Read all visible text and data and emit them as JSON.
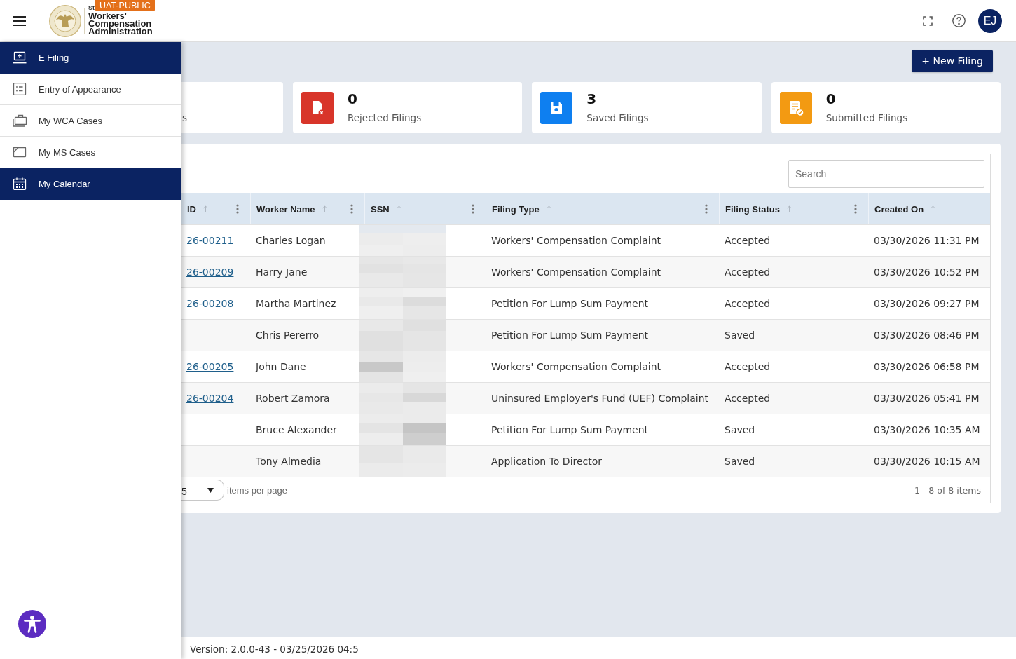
{
  "header": {
    "org_name_prefix": "St",
    "org_name": [
      "Workers'",
      "Compensation",
      "Administration"
    ],
    "environment_badge": "UAT-PUBLIC",
    "avatar_initials": "EJ"
  },
  "sidebar": {
    "items": [
      {
        "label": "E Filing",
        "selected": true
      },
      {
        "label": "Entry of Appearance",
        "selected": false
      },
      {
        "label": "My WCA Cases",
        "selected": false
      },
      {
        "label": "My MS Cases",
        "selected": false
      },
      {
        "label": "My Calendar",
        "selected": true
      }
    ]
  },
  "toolbar": {
    "new_filing_button": "+ New Filing"
  },
  "stat_cards": [
    {
      "label": "s"
    },
    {
      "count": "0",
      "label": "Rejected Filings",
      "color": "#d8352a"
    },
    {
      "count": "3",
      "label": "Saved Filings",
      "color": "#0e7ff0"
    },
    {
      "count": "0",
      "label": "Submitted Filings",
      "color": "#f39a12"
    }
  ],
  "table": {
    "search": {
      "placeholder": "Search"
    },
    "columns": [
      {
        "label": "ID",
        "has_menu": true
      },
      {
        "label": "Worker Name",
        "has_menu": true
      },
      {
        "label": "SSN",
        "has_menu": true
      },
      {
        "label": "Filing Type",
        "has_menu": true
      },
      {
        "label": "Filing Status",
        "has_menu": true
      },
      {
        "label": "Created On",
        "has_menu": false
      }
    ],
    "rows": [
      {
        "id": "26-00211",
        "worker_name": "Charles Logan",
        "filing_type": "Workers' Compensation Complaint",
        "filing_status": "Accepted",
        "created_on": "03/30/2026 11:31 PM"
      },
      {
        "id": "26-00209",
        "worker_name": "Harry Jane",
        "filing_type": "Workers' Compensation Complaint",
        "filing_status": "Accepted",
        "created_on": "03/30/2026 10:52 PM"
      },
      {
        "id": "26-00208",
        "worker_name": "Martha Martinez",
        "filing_type": "Petition For Lump Sum Payment",
        "filing_status": "Accepted",
        "created_on": "03/30/2026 09:27 PM"
      },
      {
        "worker_name": "Chris Pererro",
        "filing_type": "Petition For Lump Sum Payment",
        "filing_status": "Saved",
        "created_on": "03/30/2026 08:46 PM"
      },
      {
        "id": "26-00205",
        "worker_name": "John Dane",
        "filing_type": "Workers' Compensation Complaint",
        "filing_status": "Accepted",
        "created_on": "03/30/2026 06:58 PM"
      },
      {
        "id": "26-00204",
        "worker_name": "Robert Zamora",
        "filing_type": "Uninsured Employer's Fund (UEF) Complaint",
        "filing_status": "Accepted",
        "created_on": "03/30/2026 05:41 PM"
      },
      {
        "worker_name": "Bruce Alexander",
        "filing_type": "Petition For Lump Sum Payment",
        "filing_status": "Saved",
        "created_on": "03/30/2026 10:35 AM"
      },
      {
        "worker_name": "Tony Almedia",
        "filing_type": "Application To Director",
        "filing_status": "Saved",
        "created_on": "03/30/2026 10:15 AM"
      }
    ],
    "pagination": {
      "page_size": "5",
      "page_size_label": "items per page",
      "range": "1 - 8 of 8 items"
    }
  },
  "footer": {
    "version": "Version: 2.0.0-43 - 03/25/2026 04:5"
  }
}
